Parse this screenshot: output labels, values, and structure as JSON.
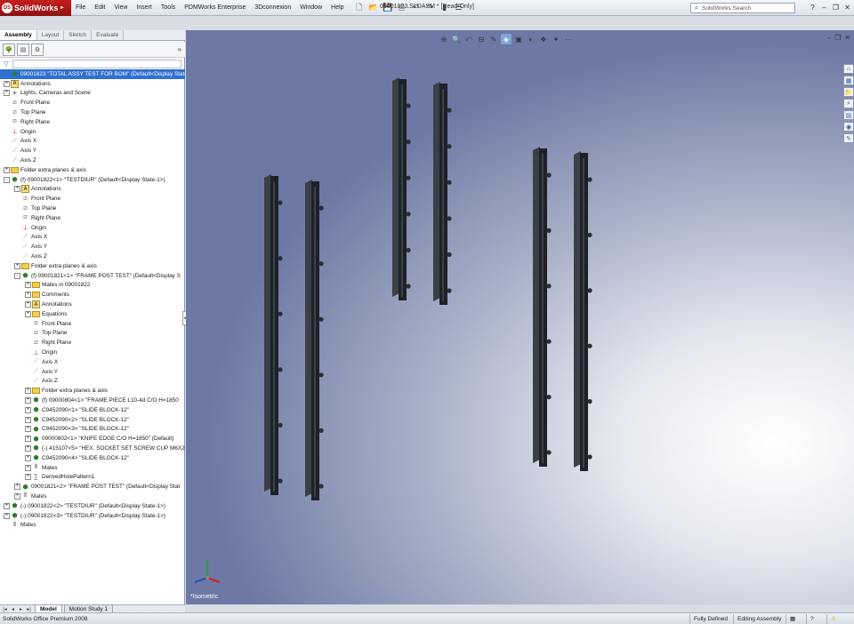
{
  "app": {
    "name": "SolidWorks",
    "document_title": "09001823.SLDASM * [Read-Only]"
  },
  "menu": [
    "File",
    "Edit",
    "View",
    "Insert",
    "Tools",
    "PDMWorks Enterprise",
    "3Dconnexion",
    "Window",
    "Help"
  ],
  "search": {
    "placeholder": "SolidWorks Search"
  },
  "command_tabs": [
    "Assembly",
    "Layout",
    "Sketch",
    "Evaluate"
  ],
  "tree": [
    {
      "indent": 0,
      "toggle": "none",
      "icon": "asm",
      "label": "09001823 \"TOTAL ASSY TEST FOR BOM\" (Default<Display State",
      "selected": true
    },
    {
      "indent": 0,
      "toggle": "+",
      "icon": "ann",
      "label": "Annotations"
    },
    {
      "indent": 0,
      "toggle": "+",
      "icon": "light",
      "label": "Lights, Cameras and Scene"
    },
    {
      "indent": 0,
      "toggle": "none",
      "icon": "plane",
      "label": "Front Plane"
    },
    {
      "indent": 0,
      "toggle": "none",
      "icon": "plane",
      "label": "Top Plane"
    },
    {
      "indent": 0,
      "toggle": "none",
      "icon": "plane",
      "label": "Right Plane"
    },
    {
      "indent": 0,
      "toggle": "none",
      "icon": "origin",
      "label": "Origin"
    },
    {
      "indent": 0,
      "toggle": "none",
      "icon": "axis",
      "label": "Axis X"
    },
    {
      "indent": 0,
      "toggle": "none",
      "icon": "axis",
      "label": "Axis Y"
    },
    {
      "indent": 0,
      "toggle": "none",
      "icon": "axis",
      "label": "Axis Z"
    },
    {
      "indent": 0,
      "toggle": "+",
      "icon": "fold",
      "label": "Folder extra planes & axis"
    },
    {
      "indent": 0,
      "toggle": "-",
      "icon": "asm",
      "label": "(f) 09001822<1> \"TESTDIUR\" (Default<Display State-1>)"
    },
    {
      "indent": 1,
      "toggle": "+",
      "icon": "ann",
      "label": "Annotations"
    },
    {
      "indent": 1,
      "toggle": "none",
      "icon": "plane",
      "label": "Front Plane"
    },
    {
      "indent": 1,
      "toggle": "none",
      "icon": "plane",
      "label": "Top Plane"
    },
    {
      "indent": 1,
      "toggle": "none",
      "icon": "plane",
      "label": "Right Plane"
    },
    {
      "indent": 1,
      "toggle": "none",
      "icon": "origin",
      "label": "Origin"
    },
    {
      "indent": 1,
      "toggle": "none",
      "icon": "axis",
      "label": "Axis X"
    },
    {
      "indent": 1,
      "toggle": "none",
      "icon": "axis",
      "label": "Axis Y"
    },
    {
      "indent": 1,
      "toggle": "none",
      "icon": "axis",
      "label": "Axis Z"
    },
    {
      "indent": 1,
      "toggle": "+",
      "icon": "fold",
      "label": "Folder extra planes & axis"
    },
    {
      "indent": 1,
      "toggle": "-",
      "icon": "asm",
      "label": "(f) 09001821<1> \"FRAME POST TEST\" (Default<Display S"
    },
    {
      "indent": 2,
      "toggle": "+",
      "icon": "fold",
      "label": "Mates in 09001822"
    },
    {
      "indent": 2,
      "toggle": "+",
      "icon": "fold",
      "label": "Comments"
    },
    {
      "indent": 2,
      "toggle": "+",
      "icon": "ann",
      "label": "Annotations"
    },
    {
      "indent": 2,
      "toggle": "+",
      "icon": "fold",
      "label": "Equations"
    },
    {
      "indent": 2,
      "toggle": "none",
      "icon": "plane",
      "label": "Front Plane"
    },
    {
      "indent": 2,
      "toggle": "none",
      "icon": "plane",
      "label": "Top Plane"
    },
    {
      "indent": 2,
      "toggle": "none",
      "icon": "plane",
      "label": "Right Plane"
    },
    {
      "indent": 2,
      "toggle": "none",
      "icon": "origin",
      "label": "Origin"
    },
    {
      "indent": 2,
      "toggle": "none",
      "icon": "axis",
      "label": "Axis X"
    },
    {
      "indent": 2,
      "toggle": "none",
      "icon": "axis",
      "label": "Axis Y"
    },
    {
      "indent": 2,
      "toggle": "none",
      "icon": "axis",
      "label": "Axis Z"
    },
    {
      "indent": 2,
      "toggle": "+",
      "icon": "fold",
      "label": "Folder extra planes & axis"
    },
    {
      "indent": 2,
      "toggle": "+",
      "icon": "asm",
      "label": "(f) 09000804<1> \"FRAME PIECE L10-4d C/O H=1850"
    },
    {
      "indent": 2,
      "toggle": "+",
      "icon": "asm",
      "label": "C9452090<1> \"SLIDE BLOCK-12\""
    },
    {
      "indent": 2,
      "toggle": "+",
      "icon": "asm",
      "label": "C9452090<2> \"SLIDE BLOCK-12\""
    },
    {
      "indent": 2,
      "toggle": "+",
      "icon": "asm",
      "label": "C9452090<3> \"SLIDE BLOCK-12\""
    },
    {
      "indent": 2,
      "toggle": "+",
      "icon": "asm",
      "label": "09000802<1> \"KNIFE EDGE C/O H=1850\" (Default)"
    },
    {
      "indent": 2,
      "toggle": "+",
      "icon": "asm",
      "label": "(-) 415107<5> \"HEX. SOCKET SET SCREW CUP M6X20"
    },
    {
      "indent": 2,
      "toggle": "+",
      "icon": "asm",
      "label": "C9452090<4> \"SLIDE BLOCK-12\""
    },
    {
      "indent": 2,
      "toggle": "+",
      "icon": "mates",
      "label": "Mates"
    },
    {
      "indent": 2,
      "toggle": "+",
      "icon": "eq",
      "label": "DerivedHolePattern1"
    },
    {
      "indent": 1,
      "toggle": "+",
      "icon": "asm",
      "label": "09001821<2> \"FRAME POST TEST\" (Default<Display Stat"
    },
    {
      "indent": 1,
      "toggle": "+",
      "icon": "mates",
      "label": "Mates"
    },
    {
      "indent": 0,
      "toggle": "+",
      "icon": "asm",
      "label": "(-) 09001822<2> \"TESTDIUR\" (Default<Display State-1>)"
    },
    {
      "indent": 0,
      "toggle": "+",
      "icon": "asm",
      "label": "(-) 09001822<3> \"TESTDIUR\" (Default<Display State-1>)"
    },
    {
      "indent": 0,
      "toggle": "none",
      "icon": "mates",
      "label": "Mates"
    }
  ],
  "bottom_tabs": [
    "Model",
    "Motion Study 1"
  ],
  "viewport": {
    "view_label": "*Isometric"
  },
  "status": {
    "app": "SolidWorks Office Premium 2008",
    "definition": "Fully Defined",
    "mode": "Editing Assembly"
  }
}
